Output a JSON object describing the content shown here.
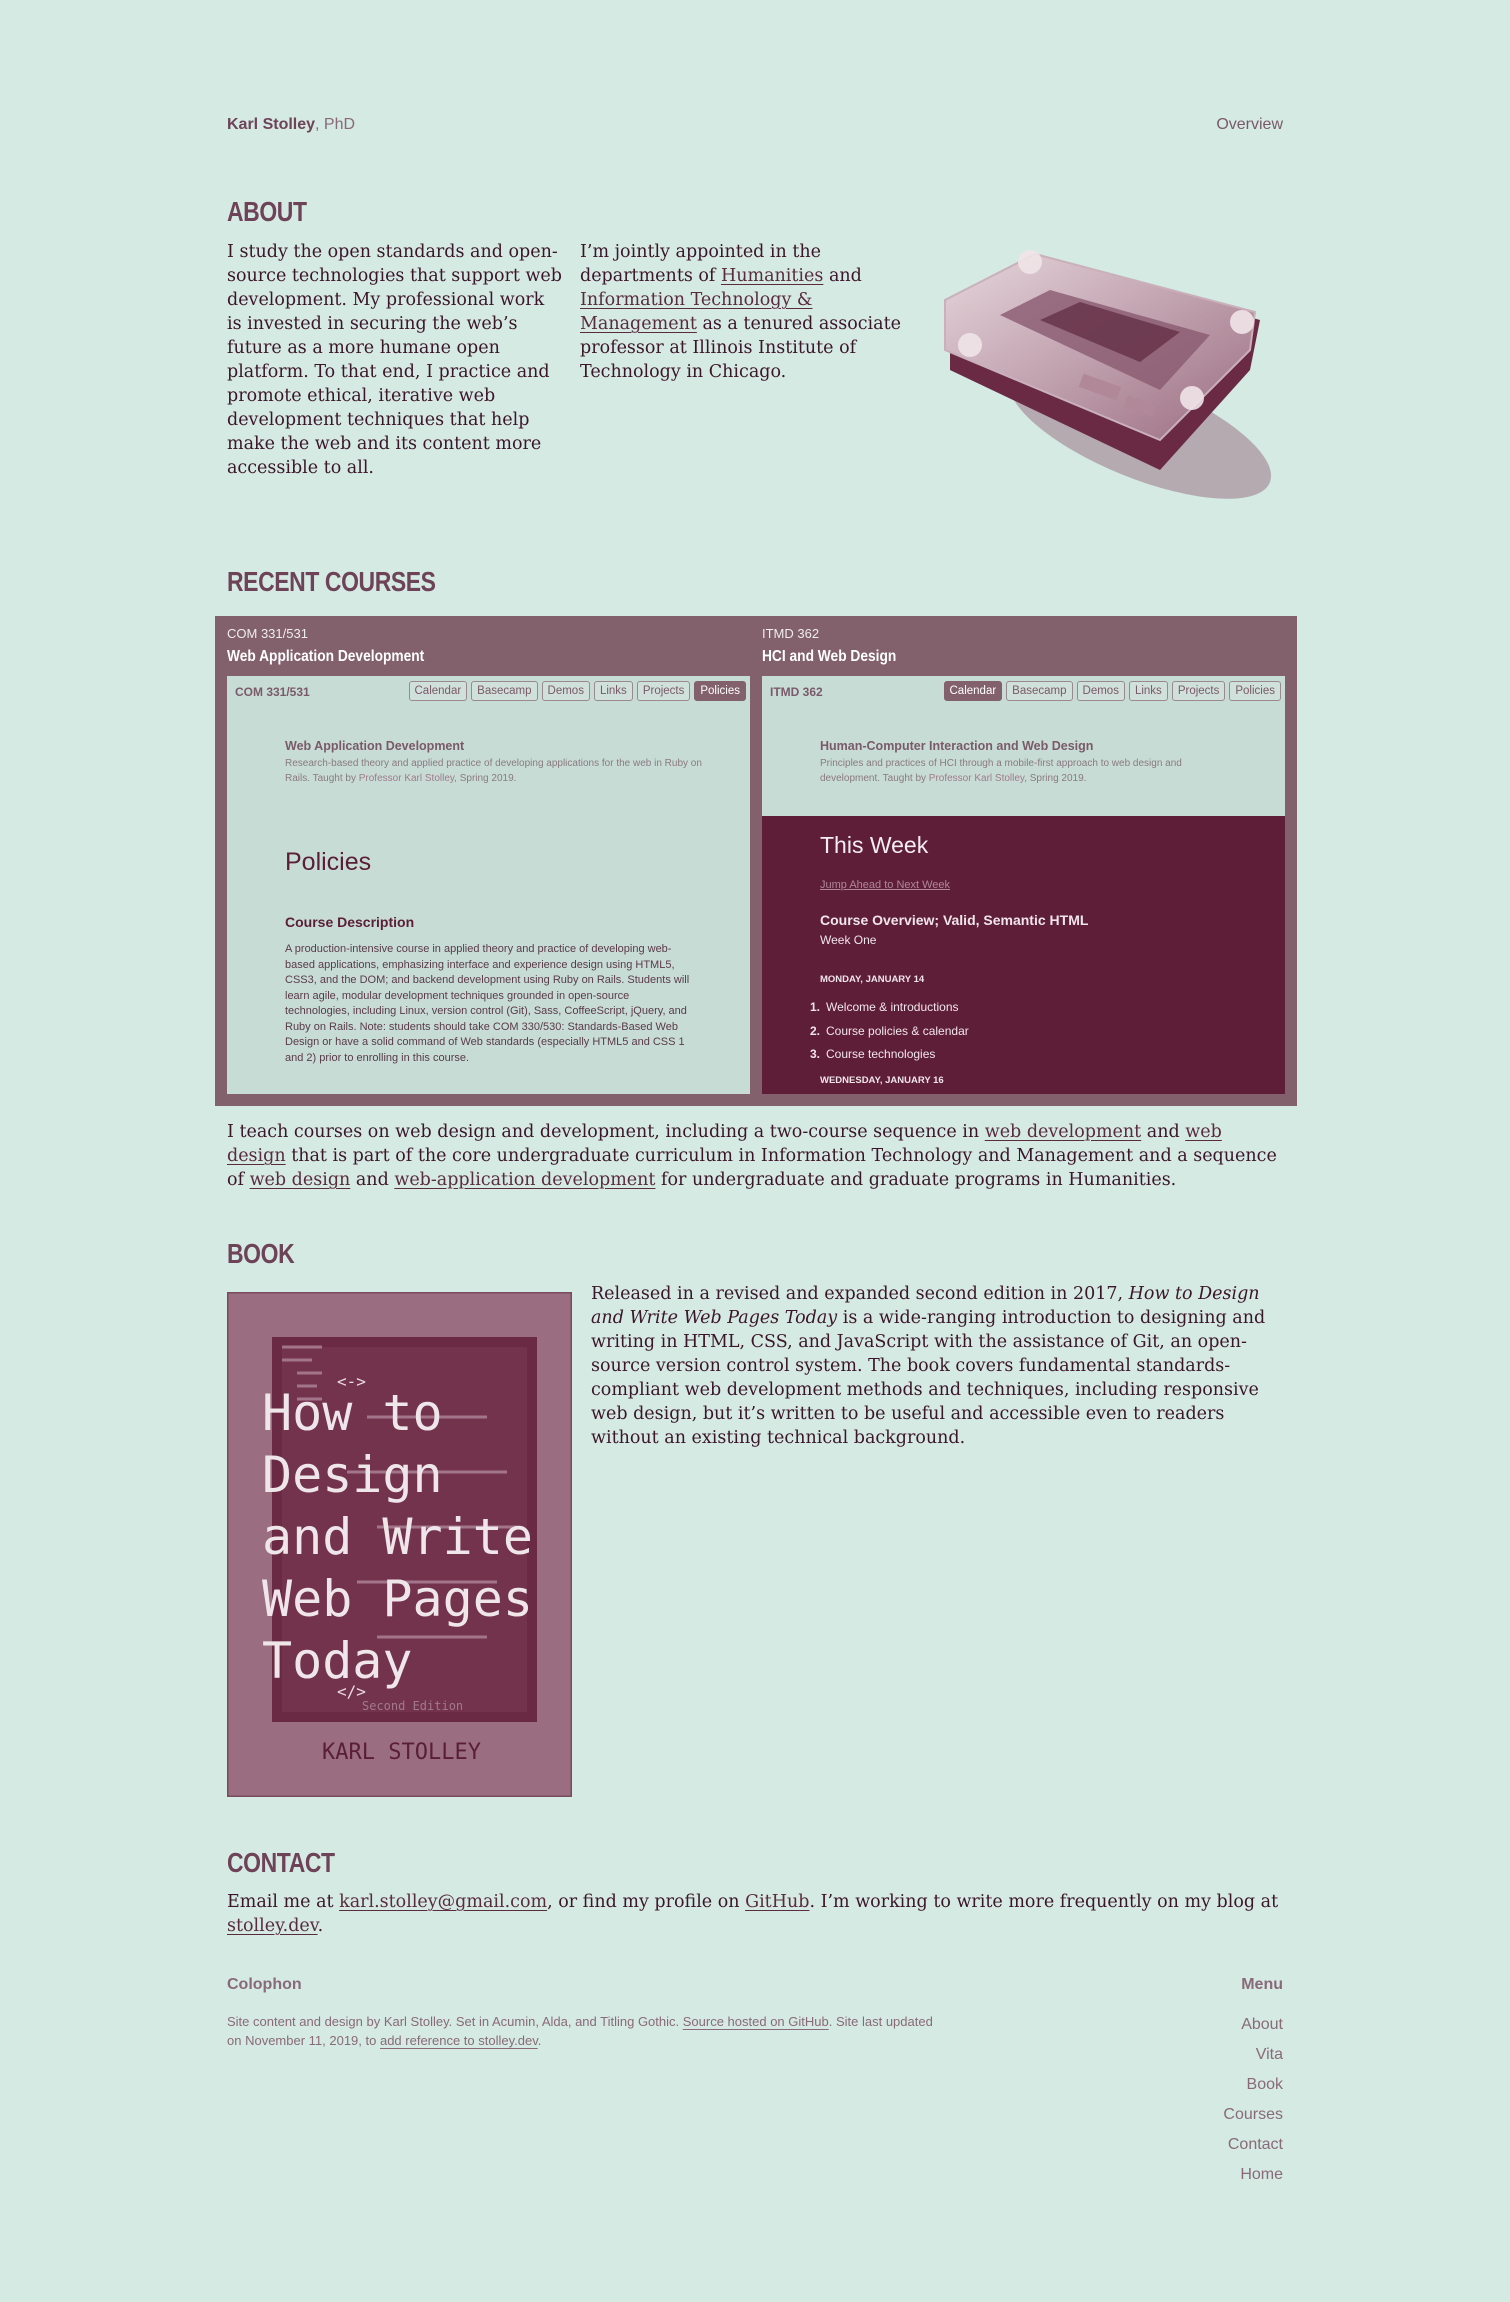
{
  "header": {
    "name": "Karl Stolley",
    "suffix": ", PhD",
    "nav_link": "Overview"
  },
  "about": {
    "heading": "About",
    "col1": "I study the open standards and open-source technologies that support web development. My professional work is invested in securing the web’s future as a more humane open platform. To that end, I practice and promote ethical, iterative web development techniques that help make the web and its content more accessible to all.",
    "col2_pre": "I’m jointly appointed in the departments of ",
    "col2_link1": "Humanities",
    "col2_mid": " and ",
    "col2_link2": "Information Technology & Management",
    "col2_post": " as a tenured associate professor at Illinois Institute of Technology in Chicago."
  },
  "courses": {
    "heading": "Recent Courses",
    "items": [
      {
        "code": "COM 331/531",
        "name": "Web Application Development",
        "tabs": [
          "Calendar",
          "Basecamp",
          "Demos",
          "Links",
          "Projects",
          "Policies"
        ],
        "active_tab": "Policies",
        "shot_code": "COM 331/531",
        "shot_title": "Web Application Development",
        "shot_desc": "Research-based theory and applied practice of developing applications for the web in Ruby on Rails. Taught by ",
        "shot_prof": "Professor Karl Stolley",
        "shot_term": ", Spring 2019.",
        "policies_heading": "Policies",
        "policies_sub": "Course Description",
        "policies_body": "A production-intensive course in applied theory and practice of developing web-based applications, emphasizing interface and experience design using HTML5, CSS3, and the DOM; and backend development using Ruby on Rails. Students will learn agile, modular development techniques grounded in open-source technologies, including Linux, version control (Git), Sass, CoffeeScript, jQuery, and Ruby on Rails. Note: students should take COM 330/530: Standards-Based Web Design or have a solid command of Web standards (especially HTML5 and CSS 1 and 2) prior to enrolling in this course."
      },
      {
        "code": "ITMD 362",
        "name": "HCI and Web Design",
        "tabs": [
          "Calendar",
          "Basecamp",
          "Demos",
          "Links",
          "Projects",
          "Policies"
        ],
        "active_tab": "Calendar",
        "shot_code": "ITMD 362",
        "shot_title": "Human-Computer Interaction and Web Design",
        "shot_desc": "Principles and practices of HCI through a mobile-first approach to web design and development. Taught by ",
        "shot_prof": "Professor Karl Stolley",
        "shot_term": ", Spring 2019.",
        "week_heading": "This Week",
        "week_jump": "Jump Ahead to Next Week",
        "week_title": "Course Overview; Valid, Semantic HTML",
        "week_sub": "Week One",
        "day1": "MONDAY, JANUARY 14",
        "day1_items": [
          "Welcome & introductions",
          "Course policies & calendar",
          "Course technologies"
        ],
        "day2": "WEDNESDAY, JANUARY 16"
      }
    ],
    "para_pre": "I teach courses on web design and development, including a two-course sequence in ",
    "link_webdev": "web development",
    "para_and1": " and ",
    "link_webdesign": "web design",
    "para_mid": " that is part of the core undergraduate curriculum in Information Technology and Management and a sequence of ",
    "link_webdesign2": "web design",
    "para_and2": " and ",
    "link_webapp": "web-application development",
    "para_post": " for undergraduate and graduate programs in Humanities."
  },
  "book": {
    "heading": "Book",
    "cover_title_lines": [
      "How to",
      "Design",
      "and Write",
      "Web Pages",
      "Today"
    ],
    "cover_edition": "Second Edition",
    "cover_author": "KARL STOLLEY",
    "para_pre": "Released in a revised and expanded second edition in 2017, ",
    "para_title": "How to Design and Write Web Pages Today",
    "para_post": " is a wide-ranging introduction to designing and writing in HTML, CSS, and JavaScript with the assistance of Git, an open-source version control system. The book covers fundamental standards-compliant web development methods and techniques, including responsive web design, but it’s written to be useful and accessible even to readers without an existing technical background."
  },
  "contact": {
    "heading": "Contact",
    "pre": "Email me at ",
    "email": "karl.stolley@gmail.com",
    "mid": ", or find my profile on ",
    "github": "GitHub",
    "mid2": ". I’m working to write more frequently on my blog at ",
    "blog": "stolley.dev",
    "post": "."
  },
  "footer": {
    "colophon_heading": "Colophon",
    "colophon_pre": "Site content and design by Karl Stolley. Set in Acumin, Alda, and Titling Gothic. ",
    "colophon_link1": "Source hosted on GitHub",
    "colophon_mid": ". Site last updated on November 11, 2019, to ",
    "colophon_link2": "add reference to stolley.dev",
    "colophon_post": ".",
    "menu_heading": "Menu",
    "menu_items": [
      "About",
      "Vita",
      "Book",
      "Courses",
      "Contact",
      "Home"
    ]
  },
  "colors": {
    "background": "#d4eae3",
    "accent": "#6e4357",
    "panel": "#82606c",
    "dark": "#5e1e37"
  }
}
